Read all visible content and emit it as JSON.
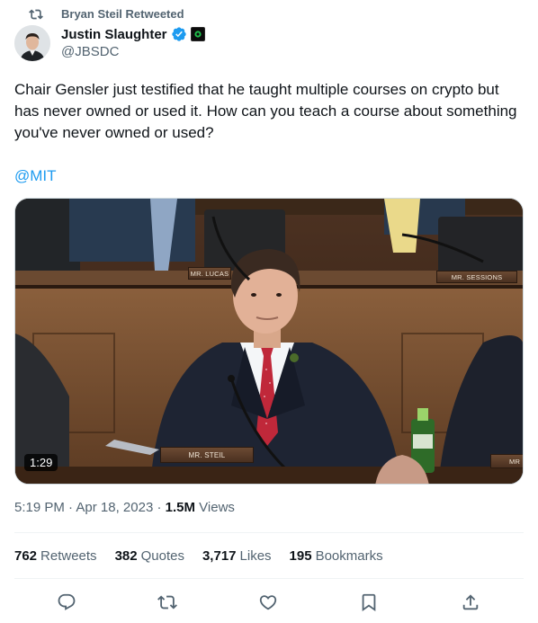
{
  "retweet": {
    "text": "Bryan Steil Retweeted",
    "icon": "retweet-icon"
  },
  "author": {
    "display_name": "Justin Slaughter",
    "handle": "@JBSDC",
    "verified_color": "#1d9bf0",
    "affiliation_badge_icon": "affiliate-badge-icon"
  },
  "tweet": {
    "text": "Chair Gensler just testified that he taught multiple courses on crypto but has never owned or used it. How can you teach a course about something you've never owned or used?",
    "mention": "@MIT",
    "video": {
      "duration": "1:29",
      "placards": [
        "MR. LUCAS",
        "MR. SESSIONS",
        "MR. STEIL",
        "MR"
      ]
    },
    "time": "5:19 PM",
    "date": "Apr 18, 2023",
    "views_count": "1.5M",
    "views_label": "Views"
  },
  "stats": {
    "retweets": {
      "count": "762",
      "label": "Retweets"
    },
    "quotes": {
      "count": "382",
      "label": "Quotes"
    },
    "likes": {
      "count": "3,717",
      "label": "Likes"
    },
    "bookmarks": {
      "count": "195",
      "label": "Bookmarks"
    }
  },
  "actions": [
    "reply-icon",
    "retweet-icon",
    "like-icon",
    "bookmark-icon",
    "share-icon"
  ],
  "colors": {
    "accent": "#1d9bf0",
    "secondary_text": "#536471",
    "primary_text": "#0f1419"
  }
}
